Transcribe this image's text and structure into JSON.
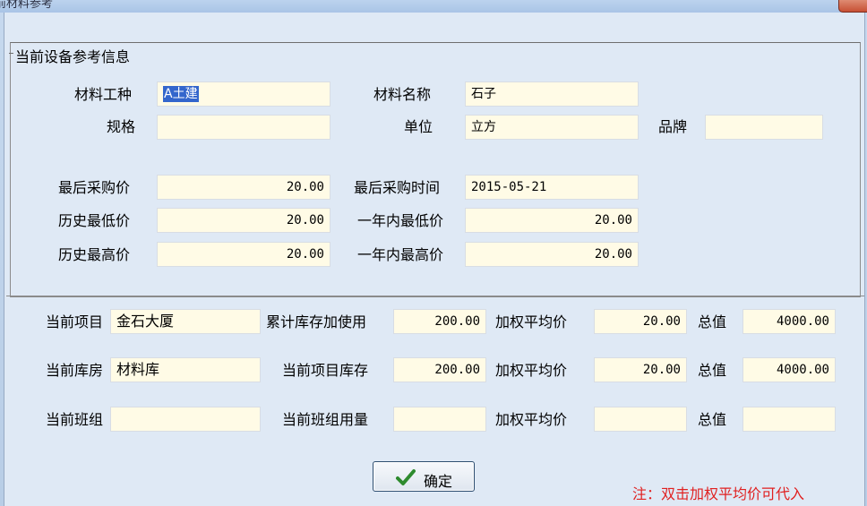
{
  "window": {
    "title": "前材料参考"
  },
  "group_title": "当前设备参考信息",
  "material": {
    "type_label": "材料工种",
    "type_value": "A土建",
    "name_label": "材料名称",
    "name_value": "石子",
    "spec_label": "规格",
    "spec_value": "",
    "unit_label": "单位",
    "unit_value": "立方",
    "brand_label": "品牌",
    "brand_value": ""
  },
  "prices": {
    "last_price_label": "最后采购价",
    "last_price": "20.00",
    "last_time_label": "最后采购时间",
    "last_time": "2015-05-21",
    "hist_min_label": "历史最低价",
    "hist_min": "20.00",
    "year_min_label": "一年内最低价",
    "year_min": "20.00",
    "hist_max_label": "历史最高价",
    "hist_max": "20.00",
    "year_max_label": "一年内最高价",
    "year_max": "20.00"
  },
  "rows": [
    {
      "label": "当前项目",
      "value": "金石大厦",
      "qty_label": "累计库存加使用",
      "qty": "200.00",
      "avg_label": "加权平均价",
      "avg": "20.00",
      "total_label": "总值",
      "total": "4000.00"
    },
    {
      "label": "当前库房",
      "value": "材料库",
      "qty_label": "当前项目库存",
      "qty": "200.00",
      "avg_label": "加权平均价",
      "avg": "20.00",
      "total_label": "总值",
      "total": "4000.00"
    },
    {
      "label": "当前班组",
      "value": "",
      "qty_label": "当前班组用量",
      "qty": "",
      "avg_label": "加权平均价",
      "avg": "",
      "total_label": "总值",
      "total": ""
    }
  ],
  "ok_button": {
    "label": "确定",
    "icon": "check-icon"
  },
  "note": "注：双击加权平均价可代入",
  "colors": {
    "field_bg": "#fffbe6",
    "note": "#e02020",
    "check": "#2e8b2e"
  }
}
